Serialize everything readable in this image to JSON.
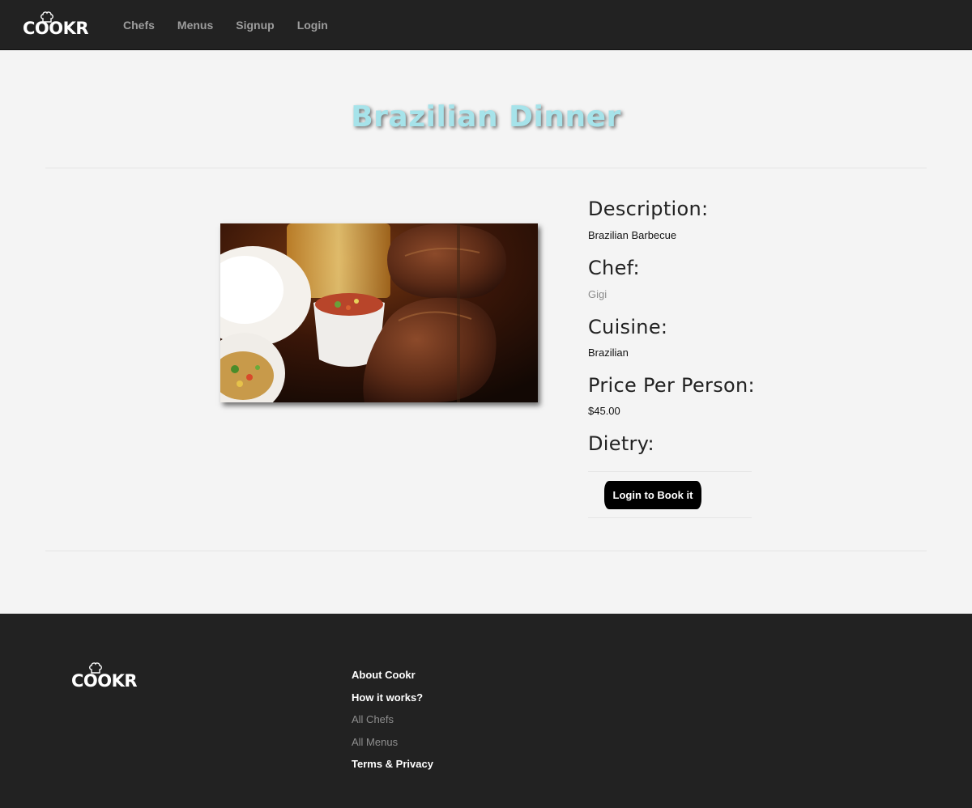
{
  "brand": {
    "name": "COOKR"
  },
  "nav": {
    "links": [
      {
        "label": "Chefs"
      },
      {
        "label": "Menus"
      },
      {
        "label": "Signup"
      },
      {
        "label": "Login"
      }
    ]
  },
  "menu": {
    "title": "Brazilian Dinner",
    "description_label": "Description:",
    "description": "Brazilian Barbecue",
    "chef_label": "Chef:",
    "chef": "Gigi",
    "cuisine_label": "Cuisine:",
    "cuisine": "Brazilian",
    "price_label": "Price Per Person:",
    "price": "$45.00",
    "dietary_label": "Dietry:",
    "book_button": "Login to Book it"
  },
  "footer": {
    "links": [
      {
        "label": "About Cookr"
      },
      {
        "label": "How it works?"
      },
      {
        "label": "All Chefs"
      },
      {
        "label": "All Menus"
      },
      {
        "label": "Terms & Privacy"
      }
    ]
  },
  "colors": {
    "navbar_bg": "#222222",
    "page_bg": "#f4f4f4",
    "title_color": "#a6e3ea",
    "button_bg": "#000000",
    "muted_text": "#8c8c8c"
  },
  "icons": {
    "logo_hat": "chef-hat-icon"
  }
}
